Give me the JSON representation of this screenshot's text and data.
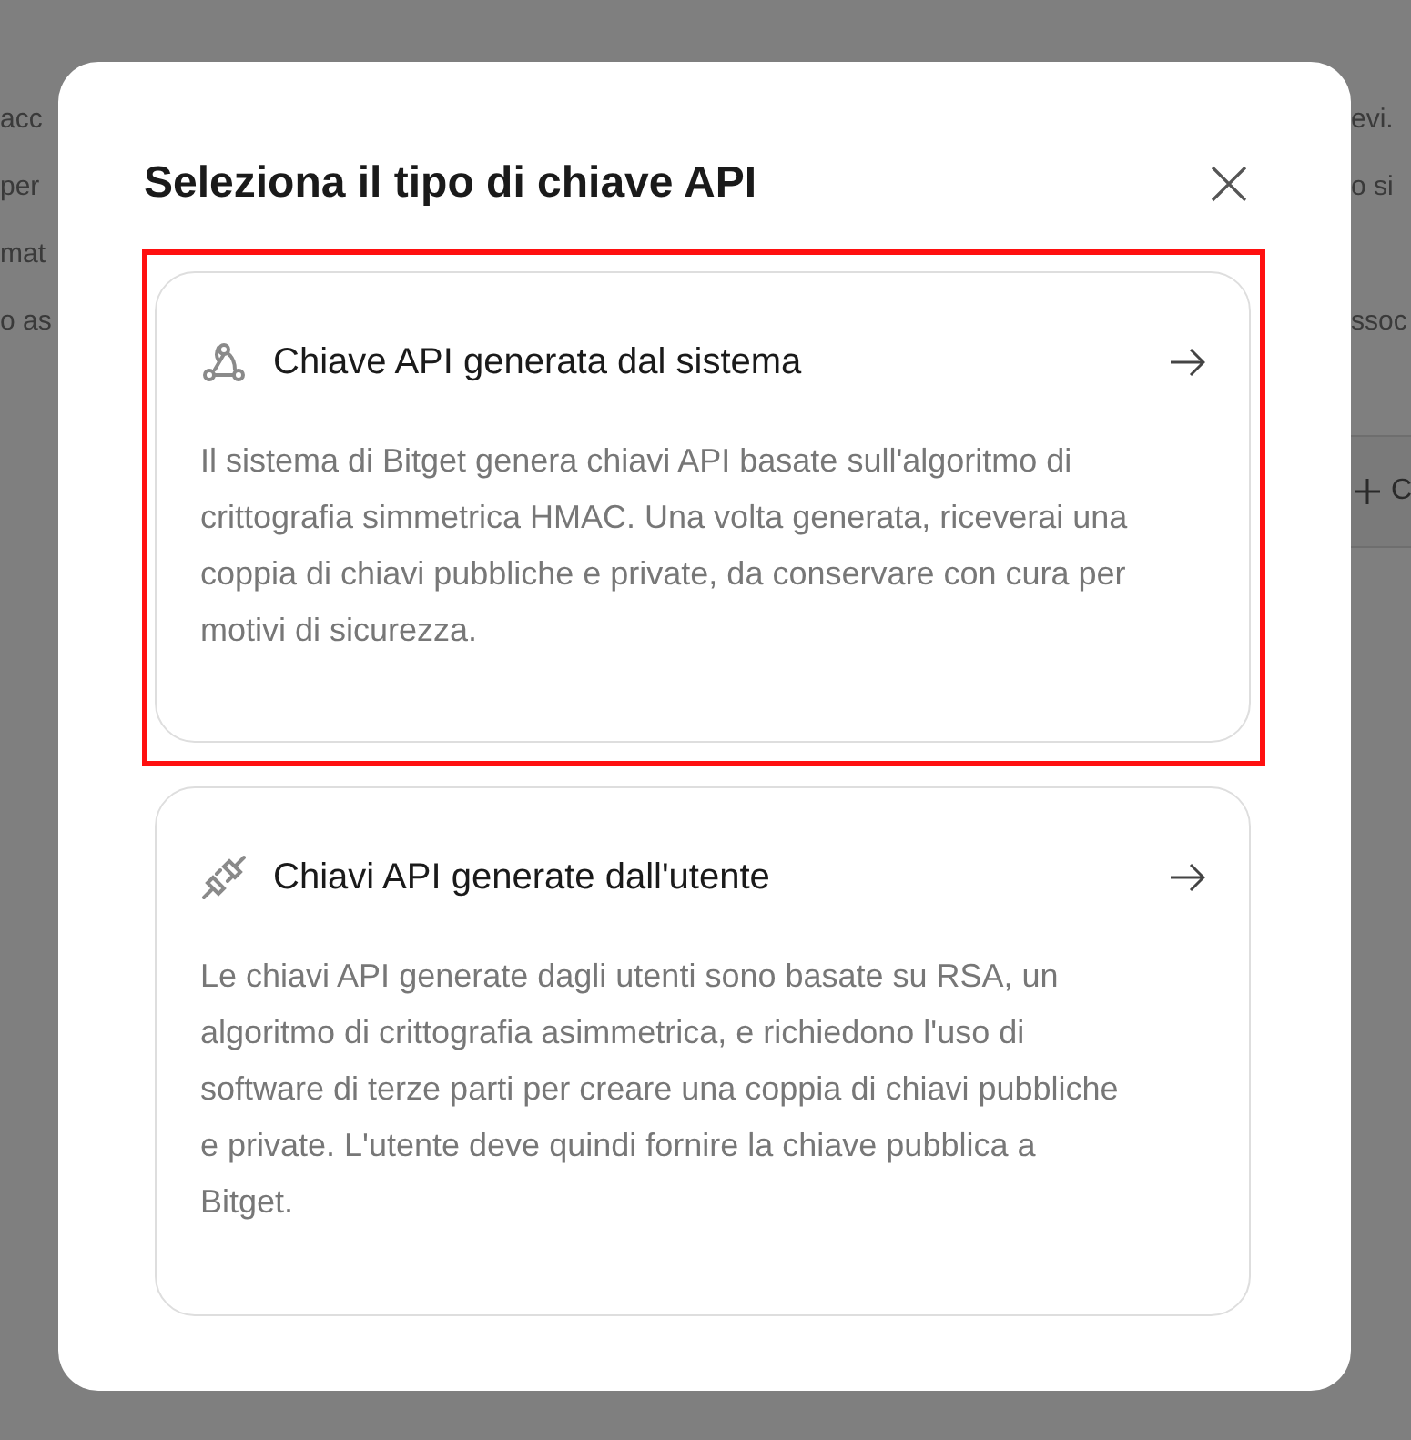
{
  "background": {
    "lines": [
      {
        "left": "acc",
        "right": "evi."
      },
      {
        "left": "per",
        "right": "o si"
      },
      {
        "left": "mat"
      },
      {
        "left": "o as",
        "right": "ssoc"
      }
    ],
    "button": {
      "label": "C"
    }
  },
  "dialog": {
    "title": "Seleziona il tipo di chiave API",
    "options": [
      {
        "kind": "system",
        "title": "Chiave API generata dal sistema",
        "description": "Il sistema di Bitget genera chiavi API basate sull'algoritmo di crittografia simmetrica HMAC. Una volta generata, riceverai una coppia di chiavi pubbliche e private, da conservare con cura per motivi di sicurezza.",
        "highlighted": true
      },
      {
        "kind": "user",
        "title": "Chiavi API generate dall'utente",
        "description": "Le chiavi API generate dagli utenti sono basate su RSA, un algoritmo di crittografia asimmetrica, e richiedono l'uso di software di terze parti per creare una coppia di chiavi pubbliche e private. L'utente deve quindi fornire la chiave pubblica a Bitget.",
        "highlighted": false
      }
    ]
  }
}
